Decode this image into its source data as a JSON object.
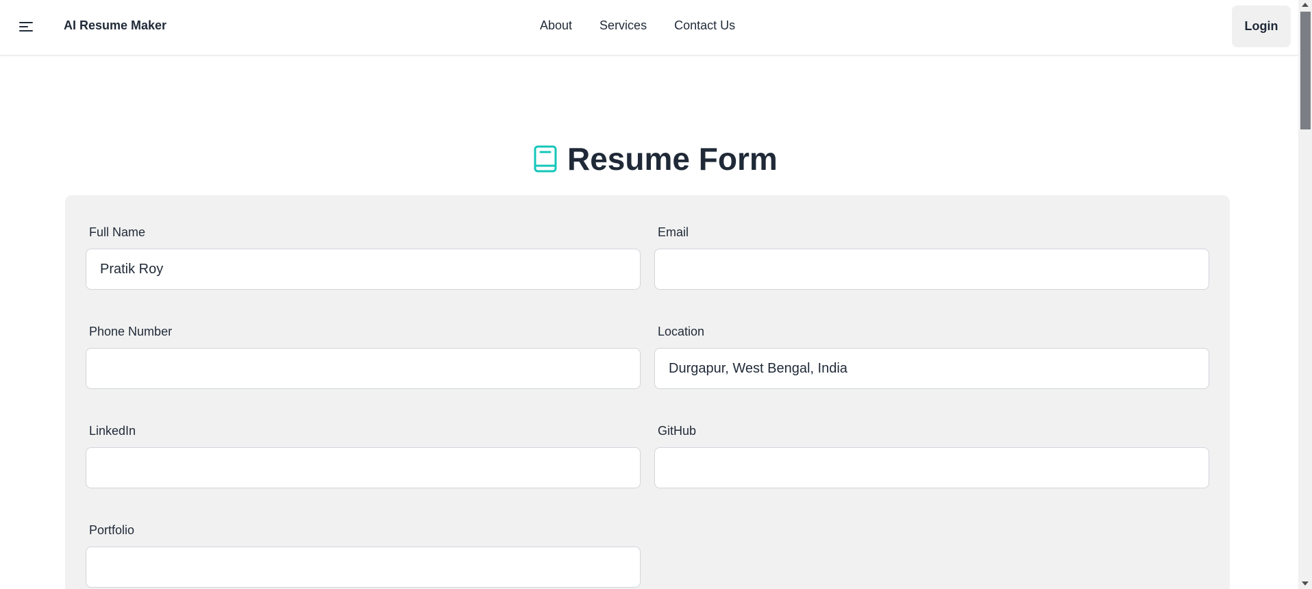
{
  "navbar": {
    "menu_icon": "hamburger-menu-icon",
    "brand": "AI Resume Maker",
    "links": [
      "About",
      "Services",
      "Contact Us"
    ],
    "login_label": "Login"
  },
  "form": {
    "title_icon": "book-icon",
    "title": "Resume Form",
    "accent_color": "#14c6b9",
    "fields": {
      "full_name": {
        "label": "Full Name",
        "value": "Pratik Roy"
      },
      "email": {
        "label": "Email",
        "value": ""
      },
      "phone": {
        "label": "Phone Number",
        "value": ""
      },
      "location": {
        "label": "Location",
        "value": "Durgapur, West Bengal, India"
      },
      "linkedin": {
        "label": "LinkedIn",
        "value": ""
      },
      "github": {
        "label": "GitHub",
        "value": ""
      },
      "portfolio": {
        "label": "Portfolio",
        "value": ""
      }
    }
  }
}
